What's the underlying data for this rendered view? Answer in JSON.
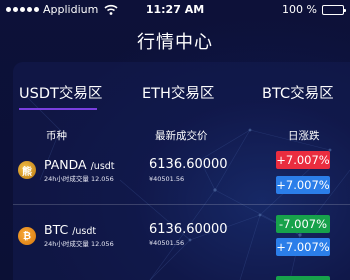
{
  "status_bar": {
    "carrier": "Applidium",
    "time": "11:27 AM",
    "battery": "100 %",
    "battery_level": 1.0,
    "icons": [
      "signal-dots-icon",
      "wifi-icon",
      "battery-icon"
    ]
  },
  "header": {
    "title": "行情中心"
  },
  "tabs": [
    {
      "label": "USDT交易区",
      "active": true
    },
    {
      "label": "ETH交易区",
      "active": false
    },
    {
      "label": "BTC交易区",
      "active": false
    }
  ],
  "columns": {
    "coin": "币种",
    "price": "最新成交价",
    "change": "日涨跌"
  },
  "rows": [
    {
      "symbol": "PANDA",
      "pair": "/usdt",
      "volume": "24h小时成交量 12.056",
      "price": "6136.60000",
      "cny": "¥40501.56",
      "change_primary": "+7.007%",
      "change_secondary": "+7.007%",
      "primary_color": "red",
      "icon": "panda-coin-icon"
    },
    {
      "symbol": "BTC",
      "pair": "/usdt",
      "volume": "24h小时成交量 12.056",
      "price": "6136.60000",
      "cny": "¥40501.56",
      "change_primary": "-7.007%",
      "change_secondary": "+7.007%",
      "primary_color": "green",
      "icon": "btc-coin-icon"
    }
  ],
  "colors": {
    "background": "#0c1037",
    "tab_underline": "#7a3fe0",
    "up": "#ea2d3f",
    "down": "#17a24b",
    "secondary": "#2b7ee9"
  }
}
